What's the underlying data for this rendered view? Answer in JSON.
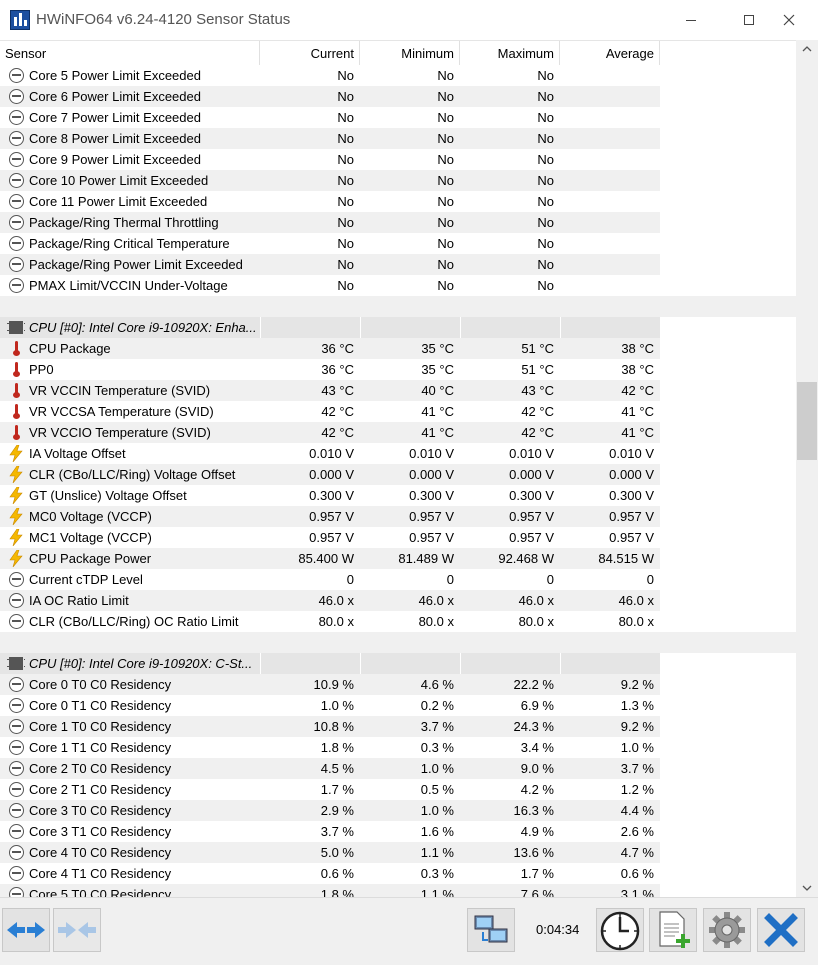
{
  "window": {
    "title": "HWiNFO64 v6.24-4120 Sensor Status",
    "controls": {
      "minimize": "minimize",
      "maximize": "maximize",
      "close": "close"
    }
  },
  "table": {
    "columns": [
      "Sensor",
      "Current",
      "Minimum",
      "Maximum",
      "Average"
    ],
    "rows": [
      {
        "type": "row",
        "icon": "circle-minus-icon",
        "name": "Core 5 Power Limit Exceeded",
        "current": "No",
        "minimum": "No",
        "maximum": "No",
        "average": ""
      },
      {
        "type": "row",
        "icon": "circle-minus-icon",
        "name": "Core 6 Power Limit Exceeded",
        "current": "No",
        "minimum": "No",
        "maximum": "No",
        "average": ""
      },
      {
        "type": "row",
        "icon": "circle-minus-icon",
        "name": "Core 7 Power Limit Exceeded",
        "current": "No",
        "minimum": "No",
        "maximum": "No",
        "average": ""
      },
      {
        "type": "row",
        "icon": "circle-minus-icon",
        "name": "Core 8 Power Limit Exceeded",
        "current": "No",
        "minimum": "No",
        "maximum": "No",
        "average": ""
      },
      {
        "type": "row",
        "icon": "circle-minus-icon",
        "name": "Core 9 Power Limit Exceeded",
        "current": "No",
        "minimum": "No",
        "maximum": "No",
        "average": ""
      },
      {
        "type": "row",
        "icon": "circle-minus-icon",
        "name": "Core 10 Power Limit Exceeded",
        "current": "No",
        "minimum": "No",
        "maximum": "No",
        "average": ""
      },
      {
        "type": "row",
        "icon": "circle-minus-icon",
        "name": "Core 11 Power Limit Exceeded",
        "current": "No",
        "minimum": "No",
        "maximum": "No",
        "average": ""
      },
      {
        "type": "row",
        "icon": "circle-minus-icon",
        "name": "Package/Ring Thermal Throttling",
        "current": "No",
        "minimum": "No",
        "maximum": "No",
        "average": ""
      },
      {
        "type": "row",
        "icon": "circle-minus-icon",
        "name": "Package/Ring Critical Temperature",
        "current": "No",
        "minimum": "No",
        "maximum": "No",
        "average": ""
      },
      {
        "type": "row",
        "icon": "circle-minus-icon",
        "name": "Package/Ring Power Limit Exceeded",
        "current": "No",
        "minimum": "No",
        "maximum": "No",
        "average": ""
      },
      {
        "type": "row",
        "icon": "circle-minus-icon",
        "name": "PMAX Limit/VCCIN Under-Voltage",
        "current": "No",
        "minimum": "No",
        "maximum": "No",
        "average": ""
      },
      {
        "type": "blank"
      },
      {
        "type": "section",
        "icon": "cpu-chip-icon",
        "name": "CPU [#0]: Intel Core i9-10920X: Enha..."
      },
      {
        "type": "row",
        "icon": "thermometer-icon",
        "name": "CPU Package",
        "current": "36 °C",
        "minimum": "35 °C",
        "maximum": "51 °C",
        "average": "38 °C"
      },
      {
        "type": "row",
        "icon": "thermometer-icon",
        "name": "PP0",
        "current": "36 °C",
        "minimum": "35 °C",
        "maximum": "51 °C",
        "average": "38 °C"
      },
      {
        "type": "row",
        "icon": "thermometer-icon",
        "name": "VR VCCIN Temperature (SVID)",
        "current": "43 °C",
        "minimum": "40 °C",
        "maximum": "43 °C",
        "average": "42 °C"
      },
      {
        "type": "row",
        "icon": "thermometer-icon",
        "name": "VR VCCSA Temperature (SVID)",
        "current": "42 °C",
        "minimum": "41 °C",
        "maximum": "42 °C",
        "average": "41 °C"
      },
      {
        "type": "row",
        "icon": "thermometer-icon",
        "name": "VR VCCIO Temperature (SVID)",
        "current": "42 °C",
        "minimum": "41 °C",
        "maximum": "42 °C",
        "average": "41 °C"
      },
      {
        "type": "row",
        "icon": "lightning-bolt-icon",
        "name": "IA Voltage Offset",
        "current": "0.010 V",
        "minimum": "0.010 V",
        "maximum": "0.010 V",
        "average": "0.010 V"
      },
      {
        "type": "row",
        "icon": "lightning-bolt-icon",
        "name": "CLR (CBo/LLC/Ring) Voltage Offset",
        "current": "0.000 V",
        "minimum": "0.000 V",
        "maximum": "0.000 V",
        "average": "0.000 V"
      },
      {
        "type": "row",
        "icon": "lightning-bolt-icon",
        "name": "GT (Unslice) Voltage Offset",
        "current": "0.300 V",
        "minimum": "0.300 V",
        "maximum": "0.300 V",
        "average": "0.300 V"
      },
      {
        "type": "row",
        "icon": "lightning-bolt-icon",
        "name": "MC0 Voltage (VCCP)",
        "current": "0.957 V",
        "minimum": "0.957 V",
        "maximum": "0.957 V",
        "average": "0.957 V"
      },
      {
        "type": "row",
        "icon": "lightning-bolt-icon",
        "name": "MC1 Voltage (VCCP)",
        "current": "0.957 V",
        "minimum": "0.957 V",
        "maximum": "0.957 V",
        "average": "0.957 V"
      },
      {
        "type": "row",
        "icon": "lightning-bolt-icon",
        "name": "CPU Package Power",
        "current": "85.400 W",
        "minimum": "81.489 W",
        "maximum": "92.468 W",
        "average": "84.515 W"
      },
      {
        "type": "row",
        "icon": "circle-minus-icon",
        "name": "Current cTDP Level",
        "current": "0",
        "minimum": "0",
        "maximum": "0",
        "average": "0"
      },
      {
        "type": "row",
        "icon": "circle-minus-icon",
        "name": "IA OC Ratio Limit",
        "current": "46.0 x",
        "minimum": "46.0 x",
        "maximum": "46.0 x",
        "average": "46.0 x"
      },
      {
        "type": "row",
        "icon": "circle-minus-icon",
        "name": "CLR (CBo/LLC/Ring) OC Ratio Limit",
        "current": "80.0 x",
        "minimum": "80.0 x",
        "maximum": "80.0 x",
        "average": "80.0 x"
      },
      {
        "type": "blank"
      },
      {
        "type": "section",
        "icon": "cpu-chip-icon",
        "name": "CPU [#0]: Intel Core i9-10920X: C-St..."
      },
      {
        "type": "row",
        "icon": "circle-minus-icon",
        "name": "Core 0 T0 C0 Residency",
        "current": "10.9 %",
        "minimum": "4.6 %",
        "maximum": "22.2 %",
        "average": "9.2 %"
      },
      {
        "type": "row",
        "icon": "circle-minus-icon",
        "name": "Core 0 T1 C0 Residency",
        "current": "1.0 %",
        "minimum": "0.2 %",
        "maximum": "6.9 %",
        "average": "1.3 %"
      },
      {
        "type": "row",
        "icon": "circle-minus-icon",
        "name": "Core 1 T0 C0 Residency",
        "current": "10.8 %",
        "minimum": "3.7 %",
        "maximum": "24.3 %",
        "average": "9.2 %"
      },
      {
        "type": "row",
        "icon": "circle-minus-icon",
        "name": "Core 1 T1 C0 Residency",
        "current": "1.8 %",
        "minimum": "0.3 %",
        "maximum": "3.4 %",
        "average": "1.0 %"
      },
      {
        "type": "row",
        "icon": "circle-minus-icon",
        "name": "Core 2 T0 C0 Residency",
        "current": "4.5 %",
        "minimum": "1.0 %",
        "maximum": "9.0 %",
        "average": "3.7 %"
      },
      {
        "type": "row",
        "icon": "circle-minus-icon",
        "name": "Core 2 T1 C0 Residency",
        "current": "1.7 %",
        "minimum": "0.5 %",
        "maximum": "4.2 %",
        "average": "1.2 %"
      },
      {
        "type": "row",
        "icon": "circle-minus-icon",
        "name": "Core 3 T0 C0 Residency",
        "current": "2.9 %",
        "minimum": "1.0 %",
        "maximum": "16.3 %",
        "average": "4.4 %"
      },
      {
        "type": "row",
        "icon": "circle-minus-icon",
        "name": "Core 3 T1 C0 Residency",
        "current": "3.7 %",
        "minimum": "1.6 %",
        "maximum": "4.9 %",
        "average": "2.6 %"
      },
      {
        "type": "row",
        "icon": "circle-minus-icon",
        "name": "Core 4 T0 C0 Residency",
        "current": "5.0 %",
        "minimum": "1.1 %",
        "maximum": "13.6 %",
        "average": "4.7 %"
      },
      {
        "type": "row",
        "icon": "circle-minus-icon",
        "name": "Core 4 T1 C0 Residency",
        "current": "0.6 %",
        "minimum": "0.3 %",
        "maximum": "1.7 %",
        "average": "0.6 %"
      },
      {
        "type": "row",
        "icon": "circle-minus-icon",
        "name": "Core 5 T0 C0 Residency",
        "current": "1.8 %",
        "minimum": "1.1 %",
        "maximum": "7.6 %",
        "average": "3.1 %"
      }
    ]
  },
  "toolbar": {
    "elapsed_time": "0:04:34",
    "buttons": [
      "expand-arrows-icon",
      "collapse-arrows-icon",
      "network-icon",
      "clock-icon",
      "report-add-icon",
      "settings-gear-icon",
      "close-x-icon"
    ]
  },
  "colors": {
    "alt_row": "#f0f0f0",
    "section_row": "#e5e5e5",
    "thermo_red": "#c0281e",
    "bolt_yellow": "#f5b800",
    "arrow_blue": "#2a7fd4",
    "close_blue": "#1f6fc5"
  }
}
